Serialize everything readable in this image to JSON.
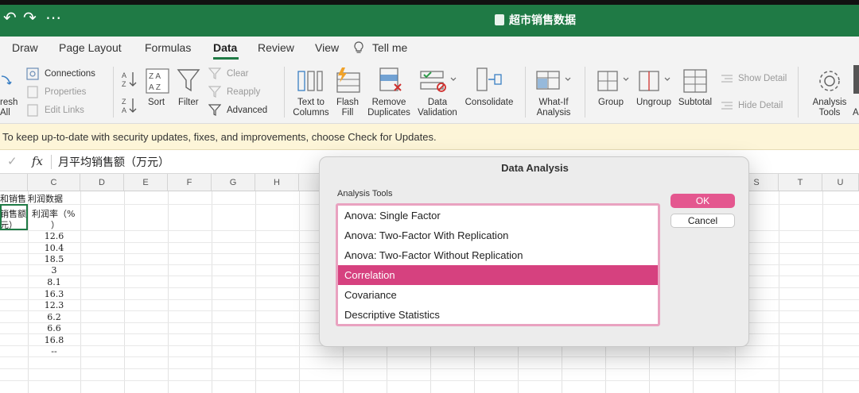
{
  "window": {
    "title": "超市销售数据",
    "controls": [
      "↶",
      "↷",
      "⋯"
    ]
  },
  "tabs": [
    {
      "label": "Draw"
    },
    {
      "label": "Page Layout"
    },
    {
      "label": "Formulas"
    },
    {
      "label": "Data"
    },
    {
      "label": "Review"
    },
    {
      "label": "View"
    },
    {
      "label": "Tell me"
    }
  ],
  "toolbar": {
    "refresh_line1": "resh",
    "refresh_line2": "All",
    "connections": "Connections",
    "properties": "Properties",
    "edit_links": "Edit Links",
    "sort": "Sort",
    "filter": "Filter",
    "clear": "Clear",
    "reapply": "Reapply",
    "advanced": "Advanced",
    "text_to_columns_1": "Text to",
    "text_to_columns_2": "Columns",
    "flash_fill_1": "Flash",
    "flash_fill_2": "Fill",
    "remove_dup_1": "Remove",
    "remove_dup_2": "Duplicates",
    "data_val_1": "Data",
    "data_val_2": "Validation",
    "consolidate": "Consolidate",
    "whatif_1": "What-If",
    "whatif_2": "Analysis",
    "group": "Group",
    "ungroup": "Ungroup",
    "subtotal": "Subtotal",
    "show_detail": "Show Detail",
    "hide_detail": "Hide Detail",
    "analysis_tools_1": "Analysis",
    "analysis_tools_2": "Tools",
    "cut_A": "A"
  },
  "notice": {
    "text": "To keep up-to-date with security updates, fixes, and improvements, choose Check for Updates."
  },
  "formula_bar": {
    "check": "✓",
    "fx": "fx",
    "value": "月平均销售额（万元）"
  },
  "grid": {
    "columns": [
      "C",
      "D",
      "E",
      "F",
      "G",
      "H",
      "S",
      "T",
      "U"
    ],
    "header_cell_b1": "和销售",
    "header_cell_c1": "利润数据",
    "cell_b2_1": "销售额",
    "cell_b2_2": "元）",
    "cell_c2_1": "利润率（%",
    "cell_c2_2": "）",
    "profit_rates": [
      "12.6",
      "10.4",
      "18.5",
      "3",
      "8.1",
      "16.3",
      "12.3",
      "6.2",
      "6.6",
      "16.8",
      "--"
    ]
  },
  "dialog": {
    "title": "Data Analysis",
    "label": "Analysis Tools",
    "items": [
      {
        "label": "Anova: Single Factor"
      },
      {
        "label": "Anova: Two-Factor With Replication"
      },
      {
        "label": "Anova: Two-Factor Without Replication"
      },
      {
        "label": "Correlation"
      },
      {
        "label": "Covariance"
      },
      {
        "label": "Descriptive Statistics"
      }
    ],
    "selected_item": "Correlation",
    "ok_label": "OK",
    "cancel_label": "Cancel"
  },
  "colors": {
    "excel_green": "#1f7a45",
    "selection_pink": "#d6417f",
    "ok_button": "#e4578f",
    "notice_bg": "#fdf5d8"
  }
}
